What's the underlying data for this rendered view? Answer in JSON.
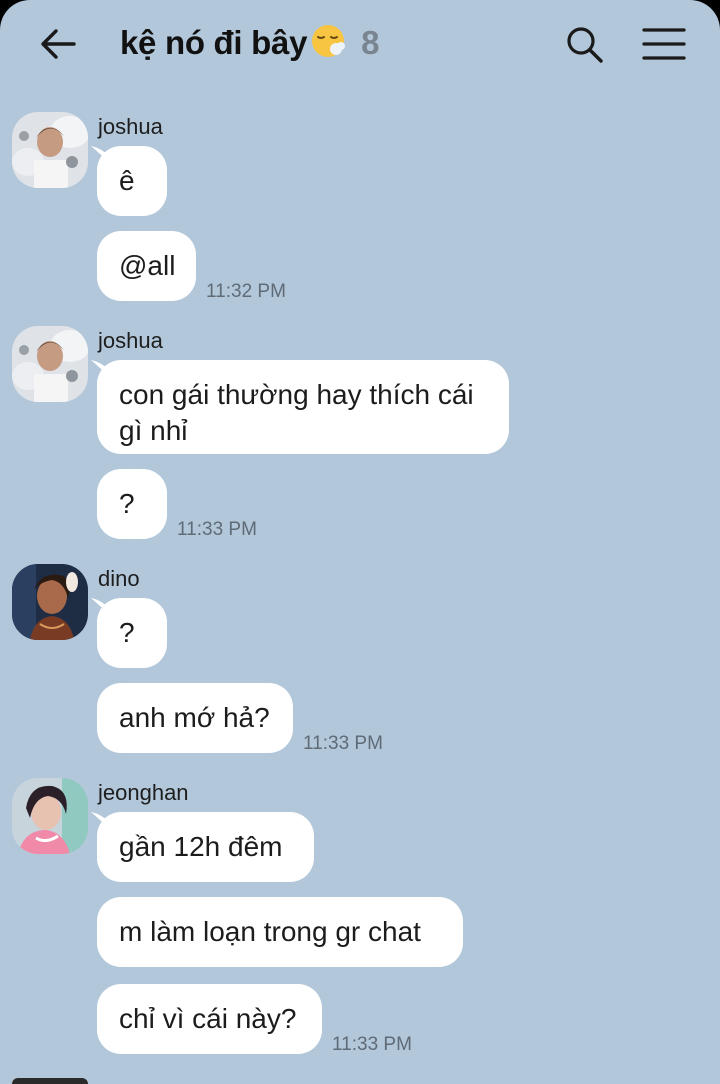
{
  "header": {
    "back_label": "back",
    "title": "kệ nó đi bây",
    "member_count": "8"
  },
  "messages": [
    {
      "sender": "joshua",
      "bubbles": [
        "ê",
        "@all"
      ],
      "time": "11:32 PM"
    },
    {
      "sender": "joshua",
      "bubbles": [
        "con gái thường hay thích cái gì nhỉ",
        "?"
      ],
      "time": "11:33 PM"
    },
    {
      "sender": "dino",
      "bubbles": [
        "?",
        "anh mớ hả?"
      ],
      "time": "11:33 PM"
    },
    {
      "sender": "jeonghan",
      "bubbles": [
        "gần 12h đêm",
        "m làm loạn trong gr chat",
        "chỉ vì cái này?"
      ],
      "time": "11:33 PM"
    }
  ],
  "colors": {
    "background": "#b2c7da",
    "bubble": "#ffffff",
    "time_text": "#5f6b77"
  },
  "icons": {
    "back": "arrow-left-icon",
    "search": "search-icon",
    "menu": "hamburger-menu-icon",
    "emoji": "face-exhaling-emoji"
  }
}
